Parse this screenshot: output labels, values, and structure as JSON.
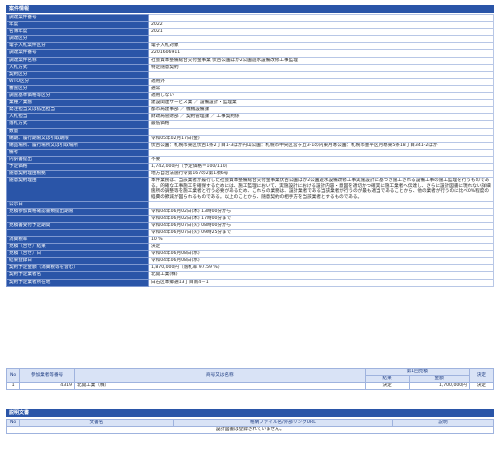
{
  "sections": {
    "info_title": "案件情報",
    "doc_title": "説明文書"
  },
  "rows": [
    {
      "label": "調達案件番号",
      "value": ""
    },
    {
      "label": "年度",
      "value": "2022"
    },
    {
      "label": "名簿年度",
      "value": "2021"
    },
    {
      "label": "調達区分",
      "value": ""
    },
    {
      "label": "電子入札案件区分",
      "value": "電子入札対象"
    },
    {
      "label": "調達案件番号",
      "value": "2201606911"
    },
    {
      "label": "調達案件名称",
      "value": "社会資本整備総合交付金事業 伏古公園ほか2公園遊水設備改修工事監理"
    },
    {
      "label": "入札方式",
      "value": "特定随意契約"
    },
    {
      "label": "契約区分",
      "value": ""
    },
    {
      "label": "WTO区分",
      "value": "適用外"
    },
    {
      "label": "審査区分",
      "value": "通常"
    },
    {
      "label": "調査基準価格等区分",
      "value": "適用しない"
    },
    {
      "label": "業種／業態",
      "value": "建設関連サービス業 ／ 設備設計・監理業"
    },
    {
      "label": "発注担当又は払出担当",
      "value": "都市局建事部 ／ 機械設備課"
    },
    {
      "label": "入札担当",
      "value": "財政局管財部 ／ 契約管理課 ／ 工事契約係"
    },
    {
      "label": "落札方式",
      "value": "最低価格"
    },
    {
      "label": "数量",
      "value": ""
    },
    {
      "label": "納期、履行期限又は引取期限",
      "value": "令和05年02月17日(金)"
    },
    {
      "label": "納品場所、履行場所又は引取場所",
      "value": "伏古公園：札幌市東区伏古1条2丁目1-3ほか円山公園：札幌市中央区宮ヶ丘3-1の内東月寒公園：札幌市豊平区月寒東5条18丁目341-2ほか"
    },
    {
      "label": "備考",
      "value": ""
    },
    {
      "label": "内訳書提出",
      "value": "不要"
    },
    {
      "label": "予定価格",
      "value": "1,742,000円（予定価格＝100/110）"
    },
    {
      "label": "随意契約理由根拠",
      "value": "地方自治法施行令第167の2第1項6号"
    },
    {
      "label": "随意契約理由",
      "value": "本件業務は、当該業者が履行した社会資本整備総合交付金事業伏古公園ほか2公園遊水設備改修工事実施設計に基づき施工される設備工事の施工監理を行うものである。的確な工事施工を確保するためには、施工監理において、実施設計における設計内容・意図を適切かつ確実に施工業者へ伝達し、さらに設計図書に現れない詳細箇所の調整等を施工業者と行う必要があるため、これらの業務は、設計業者である当該業者が行うのが最も適当であることから、他の業者が行うのに比べ0%程度の経費の節減が図られるものである。以上のことから、随意契約の相手方を当該業者とするものである。"
    },
    {
      "label": "公示日",
      "value": ""
    },
    {
      "label": "見積参加資格確認書類提出期限",
      "value": "令和04年06月02日(木) 13時00分から"
    },
    {
      "label": "",
      "value": "令和04年06月02日(木) 17時00分まで"
    },
    {
      "label": "見積書受付予定期間",
      "value": "令和04年06月07日(火) 08時00分から"
    },
    {
      "label": "",
      "value": "令和04年06月07日(火) 09時25分まで"
    },
    {
      "label": "消費税率",
      "value": "10 %"
    },
    {
      "label": "見積（合せ）結果",
      "value": "決定"
    },
    {
      "label": "見積（合せ）日",
      "value": "令和04年06月08日(水)"
    },
    {
      "label": "結果登録日",
      "value": "令和04年06月08日(水)"
    },
    {
      "label": "契約予定金額（消費税等を含む）",
      "value": "1,870,000円（落札率 97.59 %）"
    },
    {
      "label": "契約予定業者名",
      "value": "北開工業(株)"
    },
    {
      "label": "契約予定業者所在地",
      "value": "白石区本郷通13丁目南4－1"
    }
  ],
  "bid_table": {
    "headers": {
      "no": "No",
      "reg": "参加業者等番号",
      "name": "商号又は名称",
      "round1": "第1回見積",
      "result": "結果",
      "amount": "金額",
      "decision": "決定"
    },
    "rows": [
      {
        "no": "1",
        "reg": "4319",
        "name": "北開工業（株）",
        "result": "決定",
        "amount": "1,700,000円",
        "decision": "決定"
      }
    ]
  },
  "doc_table": {
    "headers": {
      "no": "No",
      "doc_name": "文書名",
      "file": "格納ファイル名/外部リンクURL",
      "desc": "説明"
    },
    "empty_message": "設計図書は登録されていません。"
  }
}
